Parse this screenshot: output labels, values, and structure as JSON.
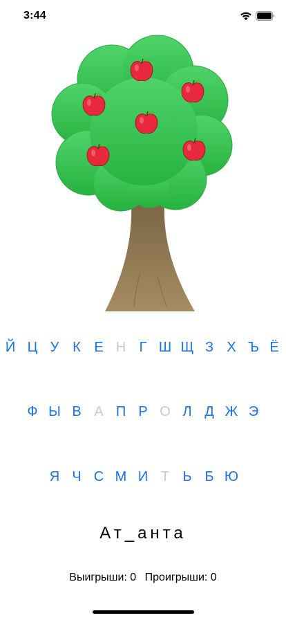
{
  "status_bar": {
    "time": "3:44",
    "icons": [
      "wifi-icon",
      "battery-icon"
    ]
  },
  "tree": {
    "apple_count": 6,
    "colors": {
      "foliage": "#3cc55a",
      "trunk": "#8f7b58",
      "apple": "#e8283c"
    }
  },
  "keyboard": {
    "accent_color": "#1a73e8",
    "disabled_color": "#c9c9c9",
    "rows": [
      {
        "keys": [
          {
            "label": "Й",
            "enabled": true
          },
          {
            "label": "Ц",
            "enabled": true
          },
          {
            "label": "У",
            "enabled": true
          },
          {
            "label": "К",
            "enabled": true
          },
          {
            "label": "Е",
            "enabled": true
          },
          {
            "label": "Н",
            "enabled": false
          },
          {
            "label": "Г",
            "enabled": true
          },
          {
            "label": "Ш",
            "enabled": true
          },
          {
            "label": "Щ",
            "enabled": true
          },
          {
            "label": "З",
            "enabled": true
          },
          {
            "label": "Х",
            "enabled": true
          },
          {
            "label": "Ъ",
            "enabled": true
          },
          {
            "label": "Ё",
            "enabled": true
          }
        ]
      },
      {
        "keys": [
          {
            "label": "Ф",
            "enabled": true
          },
          {
            "label": "Ы",
            "enabled": true
          },
          {
            "label": "В",
            "enabled": true
          },
          {
            "label": "А",
            "enabled": false
          },
          {
            "label": "П",
            "enabled": true
          },
          {
            "label": "Р",
            "enabled": true
          },
          {
            "label": "О",
            "enabled": false
          },
          {
            "label": "Л",
            "enabled": true
          },
          {
            "label": "Д",
            "enabled": true
          },
          {
            "label": "Ж",
            "enabled": true
          },
          {
            "label": "Э",
            "enabled": true
          }
        ]
      },
      {
        "keys": [
          {
            "label": "Я",
            "enabled": true
          },
          {
            "label": "Ч",
            "enabled": true
          },
          {
            "label": "С",
            "enabled": true
          },
          {
            "label": "М",
            "enabled": true
          },
          {
            "label": "И",
            "enabled": true
          },
          {
            "label": "Т",
            "enabled": false
          },
          {
            "label": "Ь",
            "enabled": true
          },
          {
            "label": "Б",
            "enabled": true
          },
          {
            "label": "Ю",
            "enabled": true
          }
        ]
      }
    ]
  },
  "word": {
    "display": "Ат_анта"
  },
  "score": {
    "wins_text": "Выигрыши: 0",
    "losses_text": "Проигрыши: 0"
  }
}
